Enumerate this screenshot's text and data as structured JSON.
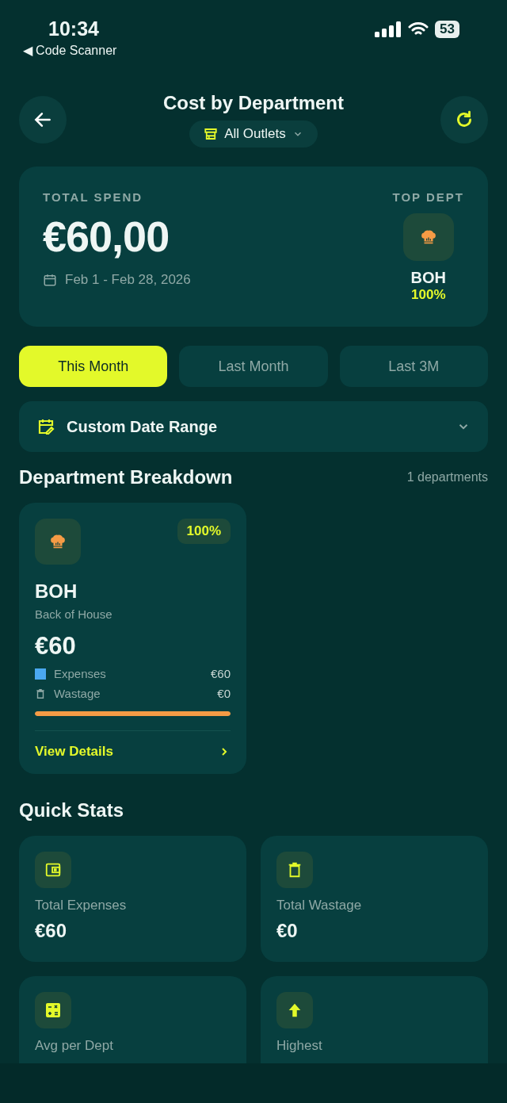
{
  "status_bar": {
    "time": "10:34",
    "back_app": "◀ Code Scanner",
    "battery": "53"
  },
  "header": {
    "title": "Cost by Department",
    "outlet_filter": "All Outlets"
  },
  "summary": {
    "label": "TOTAL SPEND",
    "amount": "€60,00",
    "date_range": "Feb 1 - Feb 28, 2026",
    "top_label": "TOP DEPT",
    "top_name": "BOH",
    "top_share": "100%"
  },
  "periods": [
    {
      "label": "This Month",
      "selected": true
    },
    {
      "label": "Last Month",
      "selected": false
    },
    {
      "label": "Last 3M",
      "selected": false
    }
  ],
  "custom_range": {
    "label": "Custom Date Range"
  },
  "breakdown": {
    "title": "Department Breakdown",
    "count": "1 departments",
    "departments": [
      {
        "share": "100%",
        "code": "BOH",
        "name": "Back of House",
        "amount": "€60",
        "lines": [
          {
            "kind": "expenses",
            "label": "Expenses",
            "value": "€60"
          },
          {
            "kind": "wastage",
            "label": "Wastage",
            "value": "€0"
          }
        ],
        "level": 1,
        "link": "View Details"
      }
    ]
  },
  "quick_stats": {
    "title": "Quick Stats",
    "stats": [
      {
        "kind": "wallet",
        "label": "Total Expenses",
        "value": "€60"
      },
      {
        "kind": "trash",
        "label": "Total Wastage",
        "value": "€0"
      },
      {
        "kind": "calculator",
        "label": "Avg per Dept"
      },
      {
        "kind": "arrow-up",
        "label": "Highest"
      }
    ]
  }
}
